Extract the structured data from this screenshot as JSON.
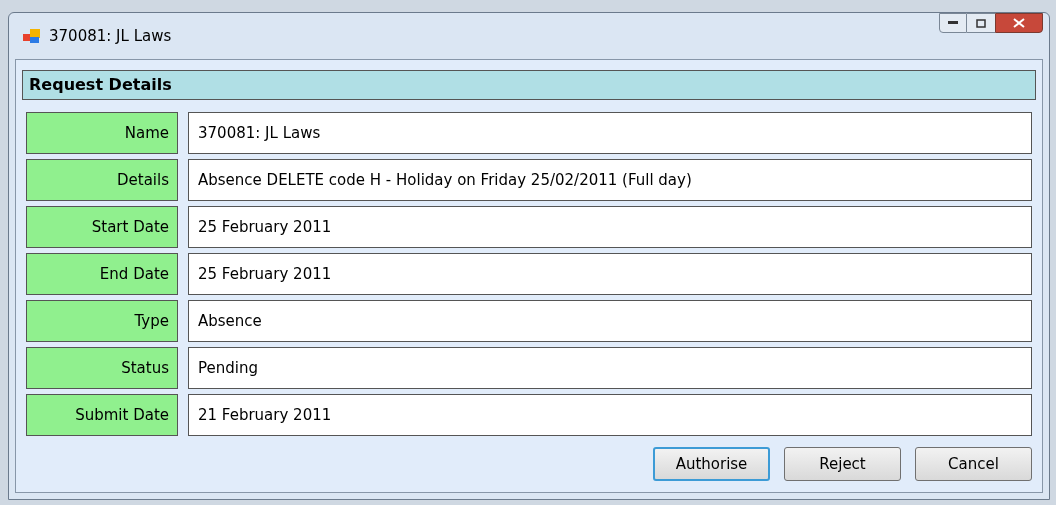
{
  "window": {
    "title": "370081: JL Laws"
  },
  "section": {
    "title": "Request Details"
  },
  "fields": [
    {
      "label": "Name",
      "value": "370081: JL Laws"
    },
    {
      "label": "Details",
      "value": "Absence DELETE code H - Holiday on Friday 25/02/2011 (Full day)"
    },
    {
      "label": "Start Date",
      "value": "25 February 2011"
    },
    {
      "label": "End Date",
      "value": "25 February 2011"
    },
    {
      "label": "Type",
      "value": "Absence"
    },
    {
      "label": "Status",
      "value": "Pending"
    },
    {
      "label": "Submit Date",
      "value": "21 February 2011"
    }
  ],
  "buttons": [
    {
      "label": "Authorise",
      "default": true
    },
    {
      "label": "Reject",
      "default": false
    },
    {
      "label": "Cancel",
      "default": false
    }
  ]
}
